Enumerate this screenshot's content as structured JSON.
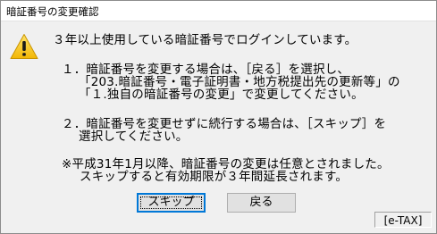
{
  "window": {
    "title": "暗証番号の変更確認"
  },
  "icon": {
    "name": "warning-icon",
    "color": "#f5c400"
  },
  "message": {
    "line1": "３年以上使用している暗証番号でログインしています。",
    "item1_line1": "１．暗証番号を変更する場合は、［戻る］を選択し、",
    "item1_line2": "「203.暗証番号・電子証明書・地方税提出先の更新等」の",
    "item1_line3": "「１.独自の暗証番号の変更」で変更してください。",
    "item2_line1": "２．暗証番号を変更せずに続行する場合は、［スキップ］を",
    "item2_line2": "選択してください。",
    "note_line1": "※平成31年1月以降、暗証番号の変更は任意とされました。",
    "note_line2": "スキップすると有効期限が３年間延長されます。"
  },
  "buttons": {
    "skip": "スキップ",
    "back": "戻る"
  },
  "app_label": "[e-TAX]"
}
